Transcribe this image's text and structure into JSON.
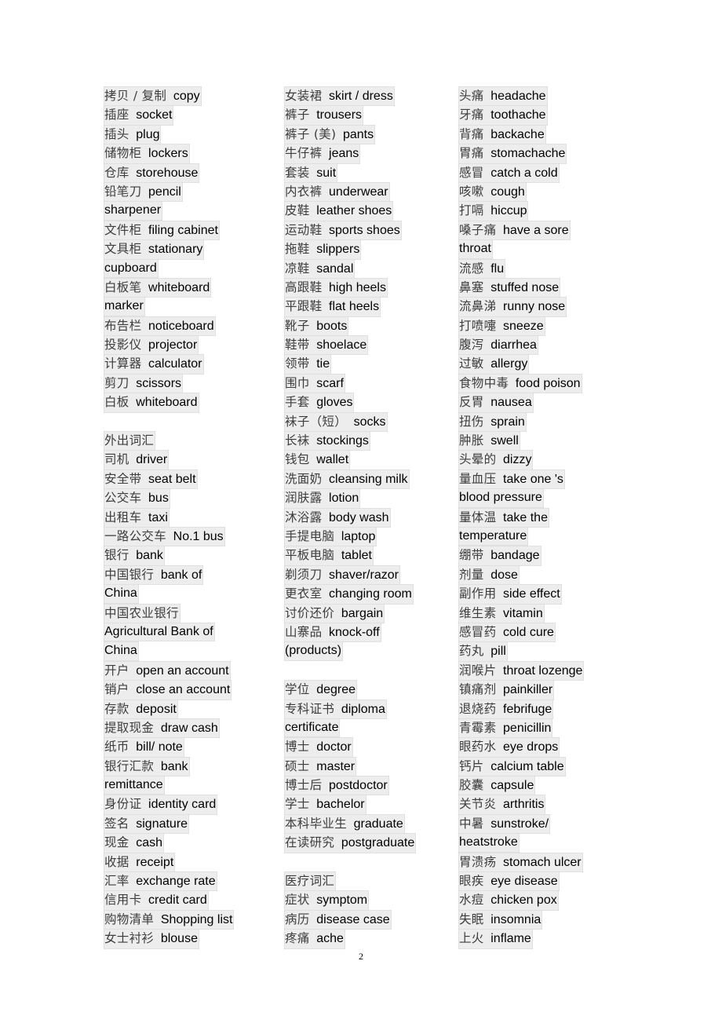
{
  "document": {
    "page_number": "2",
    "highlight_color": "#ededed",
    "chinese_text_color": "#3d3d3d",
    "english_text_color": "#000000",
    "background_color": "#ffffff"
  },
  "columns": [
    {
      "id": "column-1",
      "entries": [
        {
          "type": "entry",
          "cn": "拷贝 / 复制",
          "en": "copy"
        },
        {
          "type": "entry",
          "cn": "插座",
          "en": "socket"
        },
        {
          "type": "entry",
          "cn": "插头",
          "en": "plug"
        },
        {
          "type": "entry",
          "cn": "储物柜",
          "en": "lockers"
        },
        {
          "type": "entry",
          "cn": "仓库",
          "en": "storehouse"
        },
        {
          "type": "entry",
          "cn": "铅笔刀",
          "en": "pencil"
        },
        {
          "type": "entry",
          "cn": "",
          "en": "sharpener"
        },
        {
          "type": "entry",
          "cn": "文件柜",
          "en": "filing cabinet"
        },
        {
          "type": "entry",
          "cn": "文具柜",
          "en": "stationary"
        },
        {
          "type": "entry",
          "cn": "",
          "en": "cupboard"
        },
        {
          "type": "entry",
          "cn": "白板笔",
          "en": "whiteboard"
        },
        {
          "type": "entry",
          "cn": "",
          "en": "marker"
        },
        {
          "type": "entry",
          "cn": "布告栏",
          "en": "noticeboard"
        },
        {
          "type": "entry",
          "cn": "投影仪",
          "en": "projector"
        },
        {
          "type": "entry",
          "cn": "计算器",
          "en": "calculator"
        },
        {
          "type": "entry",
          "cn": "剪刀",
          "en": "scissors"
        },
        {
          "type": "entry",
          "cn": "白板",
          "en": "whiteboard"
        },
        {
          "type": "gap"
        },
        {
          "type": "section",
          "cn": "外出词汇",
          "en": ""
        },
        {
          "type": "entry",
          "cn": "司机",
          "en": "driver"
        },
        {
          "type": "entry",
          "cn": "安全带",
          "en": "seat belt"
        },
        {
          "type": "entry",
          "cn": "公交车",
          "en": "bus"
        },
        {
          "type": "entry",
          "cn": "出租车",
          "en": "taxi"
        },
        {
          "type": "entry",
          "cn": "一路公交车",
          "en": "No.1 bus"
        },
        {
          "type": "entry",
          "cn": "银行",
          "en": "bank"
        },
        {
          "type": "entry",
          "cn": "中国银行",
          "en": "bank of"
        },
        {
          "type": "entry",
          "cn": "",
          "en": "China"
        },
        {
          "type": "entry",
          "cn": "中国农业银行",
          "en": ""
        },
        {
          "type": "entry",
          "cn": "",
          "en": "Agricultural Bank of"
        },
        {
          "type": "entry",
          "cn": "",
          "en": "China"
        },
        {
          "type": "entry",
          "cn": "开户",
          "en": "open an account"
        },
        {
          "type": "entry",
          "cn": "销户",
          "en": "close an account"
        },
        {
          "type": "entry",
          "cn": "存款",
          "en": "deposit"
        },
        {
          "type": "entry",
          "cn": "提取现金",
          "en": "draw cash"
        },
        {
          "type": "entry",
          "cn": "纸币",
          "en": "bill/ note"
        },
        {
          "type": "entry",
          "cn": "银行汇款",
          "en": "bank"
        },
        {
          "type": "entry",
          "cn": "",
          "en": "remittance"
        },
        {
          "type": "entry",
          "cn": "身份证",
          "en": "identity card"
        },
        {
          "type": "entry",
          "cn": "签名",
          "en": "signature"
        },
        {
          "type": "entry",
          "cn": "现金",
          "en": "cash"
        },
        {
          "type": "entry",
          "cn": "收据",
          "en": "receipt"
        },
        {
          "type": "entry",
          "cn": "汇率",
          "en": "exchange rate"
        },
        {
          "type": "entry",
          "cn": "信用卡",
          "en": "credit card"
        },
        {
          "type": "entry",
          "cn": "购物清单",
          "en": "Shopping list"
        },
        {
          "type": "entry",
          "cn": "女士衬衫",
          "en": "blouse"
        }
      ]
    },
    {
      "id": "column-2",
      "entries": [
        {
          "type": "entry",
          "cn": "女装裙",
          "en": "skirt / dress"
        },
        {
          "type": "entry",
          "cn": "裤子",
          "en": "trousers"
        },
        {
          "type": "entry",
          "cn": "裤子 (美)",
          "en": "pants"
        },
        {
          "type": "entry",
          "cn": "牛仔裤",
          "en": "jeans"
        },
        {
          "type": "entry",
          "cn": "套装",
          "en": "suit"
        },
        {
          "type": "entry",
          "cn": "内衣裤",
          "en": "underwear"
        },
        {
          "type": "entry",
          "cn": "皮鞋",
          "en": "leather shoes"
        },
        {
          "type": "entry",
          "cn": "运动鞋",
          "en": "sports shoes"
        },
        {
          "type": "entry",
          "cn": "拖鞋",
          "en": "slippers"
        },
        {
          "type": "entry",
          "cn": "凉鞋",
          "en": "sandal"
        },
        {
          "type": "entry",
          "cn": "高跟鞋",
          "en": "high heels"
        },
        {
          "type": "entry",
          "cn": "平跟鞋",
          "en": "flat heels"
        },
        {
          "type": "entry",
          "cn": "靴子",
          "en": "boots"
        },
        {
          "type": "entry",
          "cn": "鞋带",
          "en": "shoelace"
        },
        {
          "type": "entry",
          "cn": "领带",
          "en": "tie"
        },
        {
          "type": "entry",
          "cn": "围巾",
          "en": "scarf"
        },
        {
          "type": "entry",
          "cn": "手套",
          "en": "gloves"
        },
        {
          "type": "entry",
          "cn": "袜子（短）",
          "en": "socks"
        },
        {
          "type": "entry",
          "cn": "长袜",
          "en": "stockings"
        },
        {
          "type": "entry",
          "cn": "钱包",
          "en": "wallet"
        },
        {
          "type": "entry",
          "cn": "洗面奶",
          "en": "cleansing milk"
        },
        {
          "type": "entry",
          "cn": "润肤露",
          "en": "lotion"
        },
        {
          "type": "entry",
          "cn": "沐浴露",
          "en": "body wash"
        },
        {
          "type": "entry",
          "cn": "手提电脑",
          "en": "laptop"
        },
        {
          "type": "entry",
          "cn": "平板电脑",
          "en": "tablet"
        },
        {
          "type": "entry",
          "cn": "剃须刀",
          "en": "shaver/razor"
        },
        {
          "type": "entry",
          "cn": "更衣室",
          "en": "changing room"
        },
        {
          "type": "entry",
          "cn": "讨价还价",
          "en": "bargain"
        },
        {
          "type": "entry",
          "cn": "山寨品",
          "en": "knock-off"
        },
        {
          "type": "entry",
          "cn": "",
          "en": "(products)"
        },
        {
          "type": "gap"
        },
        {
          "type": "entry",
          "cn": "学位",
          "en": "degree"
        },
        {
          "type": "entry",
          "cn": "专科证书",
          "en": "diploma"
        },
        {
          "type": "entry",
          "cn": "",
          "en": "certificate"
        },
        {
          "type": "entry",
          "cn": "博士",
          "en": "doctor"
        },
        {
          "type": "entry",
          "cn": "硕士",
          "en": "master"
        },
        {
          "type": "entry",
          "cn": "博士后",
          "en": "postdoctor"
        },
        {
          "type": "entry",
          "cn": "学士",
          "en": "bachelor"
        },
        {
          "type": "entry",
          "cn": "本科毕业生",
          "en": "graduate"
        },
        {
          "type": "entry",
          "cn": "在读研究",
          "en": "postgraduate"
        },
        {
          "type": "gap"
        },
        {
          "type": "section",
          "cn": "医疗词汇",
          "en": ""
        },
        {
          "type": "entry",
          "cn": "症状",
          "en": "symptom"
        },
        {
          "type": "entry",
          "cn": "病历",
          "en": "disease case"
        },
        {
          "type": "entry",
          "cn": "疼痛",
          "en": "ache"
        }
      ]
    },
    {
      "id": "column-3",
      "entries": [
        {
          "type": "entry",
          "cn": "头痛",
          "en": "headache"
        },
        {
          "type": "entry",
          "cn": "牙痛",
          "en": "toothache"
        },
        {
          "type": "entry",
          "cn": "背痛",
          "en": "backache"
        },
        {
          "type": "entry",
          "cn": "胃痛",
          "en": "stomachache"
        },
        {
          "type": "entry",
          "cn": "感冒",
          "en": "catch a cold"
        },
        {
          "type": "entry",
          "cn": "咳嗽",
          "en": "cough"
        },
        {
          "type": "entry",
          "cn": "打嗝",
          "en": "hiccup"
        },
        {
          "type": "entry",
          "cn": "嗓子痛",
          "en": "have a sore"
        },
        {
          "type": "entry",
          "cn": "",
          "en": "throat"
        },
        {
          "type": "entry",
          "cn": "流感",
          "en": "flu"
        },
        {
          "type": "entry",
          "cn": "鼻塞",
          "en": "stuffed nose"
        },
        {
          "type": "entry",
          "cn": "流鼻涕",
          "en": "runny nose"
        },
        {
          "type": "entry",
          "cn": "打喷嚏",
          "en": "sneeze"
        },
        {
          "type": "entry",
          "cn": "腹泻",
          "en": "diarrhea"
        },
        {
          "type": "entry",
          "cn": "过敏",
          "en": "allergy"
        },
        {
          "type": "entry",
          "cn": "食物中毒",
          "en": "food poison"
        },
        {
          "type": "entry",
          "cn": "反胃",
          "en": "nausea"
        },
        {
          "type": "entry",
          "cn": "扭伤",
          "en": "sprain"
        },
        {
          "type": "entry",
          "cn": "肿胀",
          "en": "swell"
        },
        {
          "type": "entry",
          "cn": "头晕的",
          "en": "dizzy"
        },
        {
          "type": "entry",
          "cn": "量血压",
          "en": "take one 's"
        },
        {
          "type": "entry",
          "cn": "",
          "en": "blood pressure"
        },
        {
          "type": "entry",
          "cn": "量体温",
          "en": "take the"
        },
        {
          "type": "entry",
          "cn": "",
          "en": "temperature"
        },
        {
          "type": "entry",
          "cn": "绷带",
          "en": "bandage"
        },
        {
          "type": "entry",
          "cn": "剂量",
          "en": "dose"
        },
        {
          "type": "entry",
          "cn": "副作用",
          "en": "side effect"
        },
        {
          "type": "entry",
          "cn": "维生素",
          "en": "vitamin"
        },
        {
          "type": "entry",
          "cn": "感冒药",
          "en": "cold cure"
        },
        {
          "type": "entry",
          "cn": "药丸",
          "en": "pill"
        },
        {
          "type": "entry",
          "cn": "润喉片",
          "en": "throat lozenge"
        },
        {
          "type": "entry",
          "cn": "镇痛剂",
          "en": "painkiller"
        },
        {
          "type": "entry",
          "cn": "退烧药",
          "en": "febrifuge"
        },
        {
          "type": "entry",
          "cn": "青霉素",
          "en": "penicillin"
        },
        {
          "type": "entry",
          "cn": "眼药水",
          "en": "eye drops"
        },
        {
          "type": "entry",
          "cn": "钙片",
          "en": "calcium table"
        },
        {
          "type": "entry",
          "cn": "胶囊",
          "en": "capsule"
        },
        {
          "type": "entry",
          "cn": "关节炎",
          "en": "arthritis"
        },
        {
          "type": "entry",
          "cn": "中暑",
          "en": "sunstroke/"
        },
        {
          "type": "entry",
          "cn": "",
          "en": "heatstroke"
        },
        {
          "type": "entry",
          "cn": "胃溃疡",
          "en": "stomach ulcer"
        },
        {
          "type": "entry",
          "cn": "眼疾",
          "en": "eye disease"
        },
        {
          "type": "entry",
          "cn": "水痘",
          "en": "chicken pox"
        },
        {
          "type": "entry",
          "cn": "失眠",
          "en": "insomnia"
        },
        {
          "type": "entry",
          "cn": "上火",
          "en": "inflame"
        }
      ]
    }
  ]
}
